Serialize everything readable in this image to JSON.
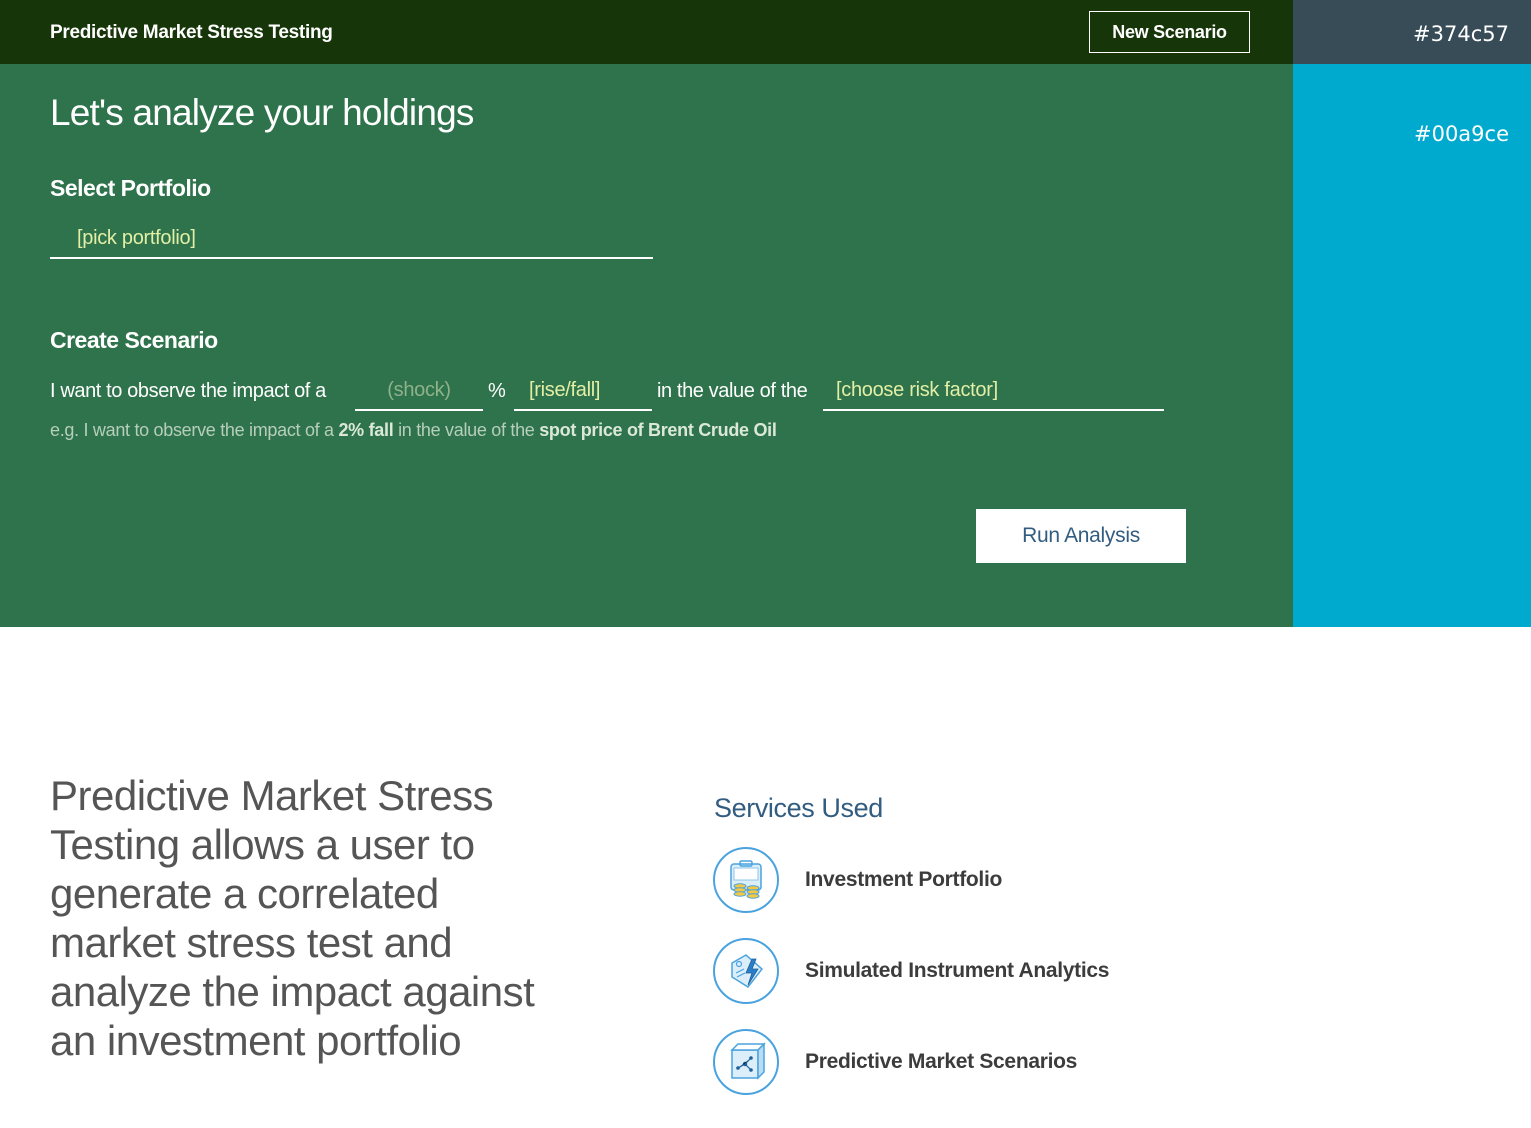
{
  "header": {
    "title": "Predictive Market Stress Testing",
    "new_scenario_label": "New Scenario"
  },
  "swatches": [
    {
      "label": "#374c57",
      "color": "#374c57"
    },
    {
      "label": "#00a9ce",
      "color": "#00a9ce"
    }
  ],
  "form": {
    "heading": "Let's analyze your holdings",
    "portfolio": {
      "label": "Select Portfolio",
      "value": "[pick portfolio]"
    },
    "scenario": {
      "label": "Create Scenario",
      "text_before_shock": "I want to observe the impact of a",
      "shock_placeholder": "(shock)",
      "percent_symbol": "%",
      "direction_value": "[rise/fall]",
      "text_before_factor": "in the value of the",
      "risk_factor_value": "[choose risk factor]",
      "example": {
        "prefix": "e.g. I want to observe the impact of a ",
        "shock": "2% fall",
        "middle": " in the value of the ",
        "factor": "spot price of Brent Crude Oil"
      }
    },
    "run_label": "Run Analysis"
  },
  "description": "Predictive Market Stress Testing allows a user to generate a correlated market stress test and analyze the impact against an investment portfolio",
  "services": {
    "heading": "Services Used",
    "items": [
      {
        "name": "Investment Portfolio",
        "icon": "investment-portfolio-icon"
      },
      {
        "name": "Simulated Instrument Analytics",
        "icon": "instrument-analytics-icon"
      },
      {
        "name": "Predictive Market Scenarios",
        "icon": "market-scenarios-icon"
      }
    ]
  },
  "colors": {
    "header_bg": "#163508",
    "panel_bg": "#2e734b",
    "accent_blue": "#325c80",
    "field_text": "#e3eea6"
  }
}
